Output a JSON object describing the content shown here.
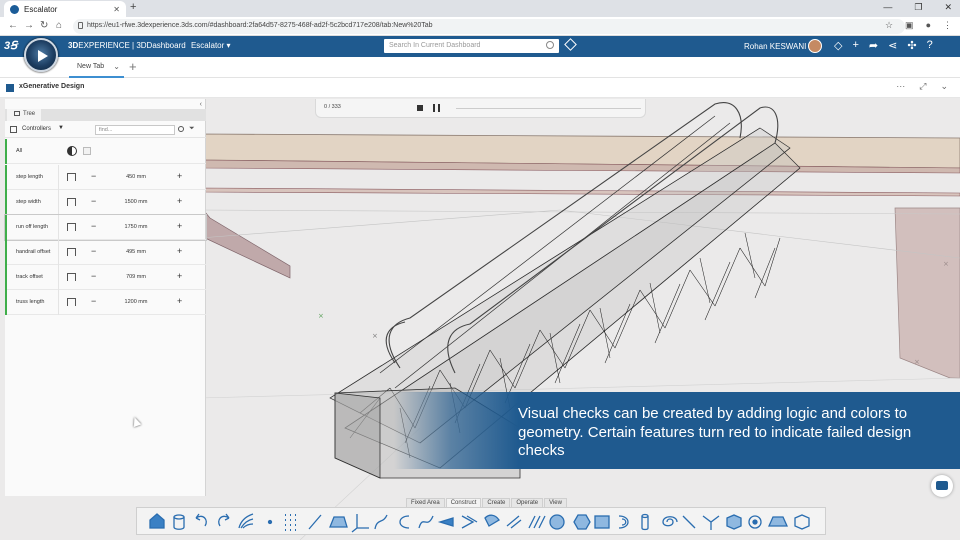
{
  "browser": {
    "tab_title": "Escalator",
    "url": "https://eu1-rfwe.3dexperience.3ds.com/#dashboard:2fa64d57-8275-468f-ad2f-5c2bcd717e208/tab:New%20Tab"
  },
  "header": {
    "brand_bold": "3D",
    "brand_rest": "EXPERIENCE | 3DDashboard",
    "dashboard_name": "Escalator",
    "search_placeholder": "Search In Current Dashboard",
    "user_name": "Rohan KESWANI"
  },
  "tabs": {
    "active": "New Tab"
  },
  "widget": {
    "title": "xGenerative Design"
  },
  "panel": {
    "tab_label": "Tree",
    "controllers_label": "Controllers",
    "find_placeholder": "find...",
    "all_label": "All",
    "rows": [
      {
        "label": "step length",
        "value": "450 mm"
      },
      {
        "label": "step width",
        "value": "1500 mm"
      },
      {
        "label": "run off length",
        "value": "1750 mm"
      },
      {
        "label": "handrail offset",
        "value": "495 mm"
      },
      {
        "label": "track offset",
        "value": "709 mm"
      },
      {
        "label": "truss length",
        "value": "1200 mm"
      }
    ]
  },
  "player": {
    "frame": "0 / 333"
  },
  "caption": {
    "text": "Visual checks can be created by adding logic and colors to geometry. Certain features turn red to indicate failed design checks"
  },
  "action_bar": {
    "tabs": [
      "Fixed Area",
      "Construct",
      "Create",
      "Operate",
      "View"
    ],
    "active_tab": "Construct"
  },
  "colors": {
    "brand_blue": "#1f5a8f",
    "controller_green": "#3fae4a",
    "caption_blue": "#1f5a8f"
  }
}
